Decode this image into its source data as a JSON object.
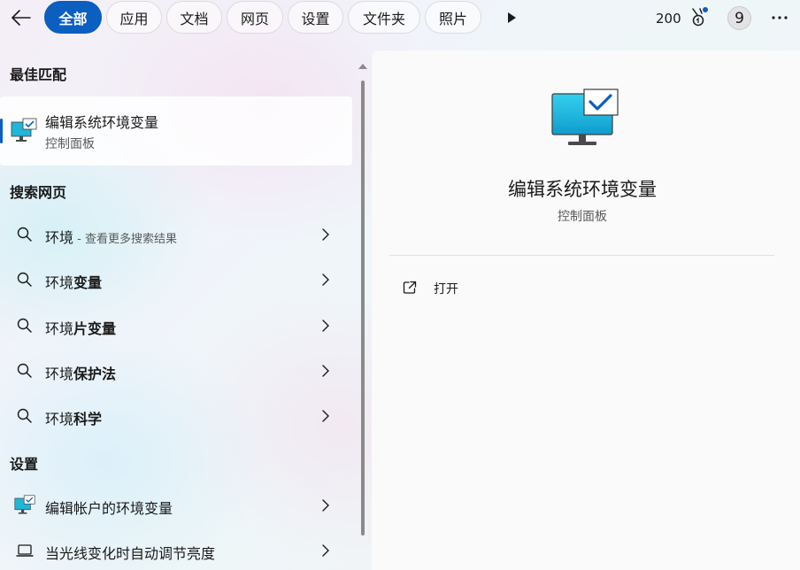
{
  "tabs": [
    {
      "label": "全部",
      "active": true
    },
    {
      "label": "应用"
    },
    {
      "label": "文档"
    },
    {
      "label": "网页"
    },
    {
      "label": "设置"
    },
    {
      "label": "文件夹"
    },
    {
      "label": "照片"
    }
  ],
  "topbar": {
    "points": "200",
    "avatar_letter": "9"
  },
  "best_match": {
    "section_title": "最佳匹配",
    "title": "编辑系统环境变量",
    "subtitle": "控制面板"
  },
  "web_search": {
    "section_title": "搜索网页",
    "items": [
      {
        "prefix": "环境",
        "bold": "",
        "hint": " - 查看更多搜索结果"
      },
      {
        "prefix": "环境",
        "bold": "变量",
        "hint": ""
      },
      {
        "prefix": "环境",
        "bold": "片变量",
        "hint": ""
      },
      {
        "prefix": "环境",
        "bold": "保护法",
        "hint": ""
      },
      {
        "prefix": "环境",
        "bold": "科学",
        "hint": ""
      }
    ]
  },
  "settings": {
    "section_title": "设置",
    "items": [
      {
        "label": "编辑帐户的环境变量",
        "icon": "monitor-check-icon"
      },
      {
        "label": "当光线变化时自动调节亮度",
        "icon": "laptop-icon"
      }
    ]
  },
  "detail": {
    "title": "编辑系统环境变量",
    "subtitle": "控制面板",
    "action_open": "打开"
  },
  "colors": {
    "accent": "#0a5fc0",
    "icon_cyan": "#1fb6d9"
  }
}
